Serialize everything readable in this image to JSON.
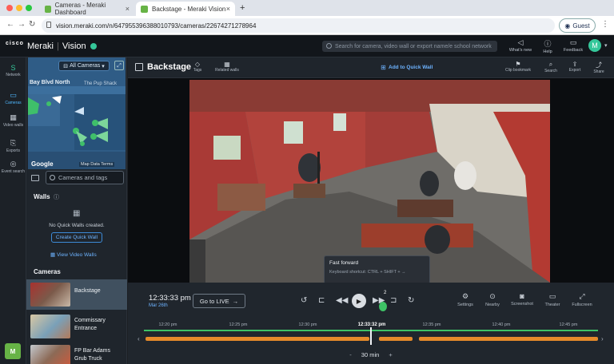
{
  "browser": {
    "tabs": [
      {
        "title": "Cameras - Meraki Dashboard",
        "active": false
      },
      {
        "title": "Backstage - Meraki Vision",
        "active": true
      }
    ],
    "url": "vision.meraki.com/n/647955396388010793/cameras/22674271278964",
    "guest_label": "Guest"
  },
  "header": {
    "cisco_label": "cisco",
    "brand": "Meraki",
    "product": "Vision",
    "search_placeholder": "Search for camera, video wall or export name/e school network",
    "icons": [
      {
        "name": "whats-new",
        "label": "What's new"
      },
      {
        "name": "help",
        "label": "Help"
      },
      {
        "name": "feedback",
        "label": "Feedback"
      }
    ],
    "avatar_letter": "M"
  },
  "leftnav": {
    "items": [
      {
        "name": "network",
        "glyph": "S",
        "label": "Network"
      },
      {
        "name": "cameras",
        "glyph": "▭",
        "label": "Cameras"
      },
      {
        "name": "video-walls",
        "glyph": "▦",
        "label": "Video walls"
      },
      {
        "name": "exports",
        "glyph": "⎘",
        "label": "Exports"
      },
      {
        "name": "event-search",
        "glyph": "◎",
        "label": "Event search"
      }
    ],
    "logo": "M"
  },
  "sidebar": {
    "map": {
      "filter_label": "All Cameras",
      "street": "Bay Blvd North",
      "place": "The Pup Shack",
      "google": "Google",
      "map_data": "Map Data   Terms"
    },
    "camera_search_placeholder": "Cameras and tags",
    "walls": {
      "heading": "Walls",
      "empty_text": "No Quick Walls created.",
      "create_button": "Create Quick Wall",
      "view_link": "View Video Walls"
    },
    "cameras_heading": "Cameras",
    "cameras": [
      {
        "name": "Backstage",
        "selected": true
      },
      {
        "name": "Commissary Entrance",
        "selected": false
      },
      {
        "name": "FP Bar Adams Grub Truck",
        "selected": false
      }
    ]
  },
  "camera_view": {
    "title": "Backstage",
    "toolbar_left": [
      {
        "name": "tags",
        "label": "Tags"
      },
      {
        "name": "related-walls",
        "label": "Related walls"
      }
    ],
    "add_quick_wall": "Add to Quick Wall",
    "toolbar_right": [
      {
        "name": "clip-bookmark",
        "label": "Clip bookmark"
      },
      {
        "name": "search",
        "label": "Search"
      },
      {
        "name": "export",
        "label": "Export"
      },
      {
        "name": "share",
        "label": "Share"
      }
    ]
  },
  "tooltip": {
    "title": "Fast forward",
    "shortcut": "Keyboard shortcut:  CTRL  +  SHIFT  +  →"
  },
  "playback": {
    "time": "12:33:33 pm",
    "date": "Mar 26th",
    "go_live": "Go to LIVE",
    "speed_badge": "2",
    "right_controls": [
      {
        "name": "settings",
        "label": "Settings"
      },
      {
        "name": "nearby",
        "label": "Nearby"
      },
      {
        "name": "screenshot",
        "label": "Screenshot"
      },
      {
        "name": "theater",
        "label": "Theater"
      },
      {
        "name": "fullscreen",
        "label": "Fullscreen"
      }
    ],
    "ticks": [
      "12:20 pm",
      "12:25 pm",
      "12:30 pm",
      "12:33:32 pm",
      "12:35 pm",
      "12:40 pm",
      "12:45 pm"
    ],
    "zoom": {
      "minus": "-",
      "label": "30 min",
      "plus": "+"
    }
  },
  "colors": {
    "accent_blue": "#4fb8ff",
    "timeline_green": "#3ec266",
    "motion_orange": "#e58a2a",
    "meraki_green": "#67b346"
  }
}
